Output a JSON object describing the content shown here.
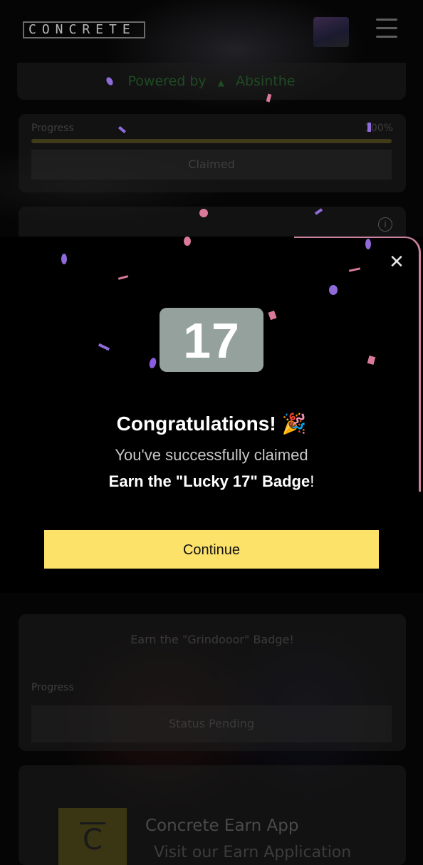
{
  "header": {
    "logo_text": "CONCRETE"
  },
  "powered": {
    "prefix": "Powered by",
    "brand": "Absinthe"
  },
  "quest_claimed": {
    "progress_label": "Progress",
    "progress_value": "100%",
    "status_label": "Claimed"
  },
  "modal": {
    "badge_text": "17",
    "title": "Congratulations!",
    "title_emoji": "🎉",
    "subtitle_line1": "You've successfully claimed",
    "claimed_item": "Earn the \"Lucky 17\" Badge",
    "claimed_item_suffix": "!",
    "continue_label": "Continue",
    "accent_color": "#fde26a"
  },
  "quest_pending": {
    "title": "Earn the \"Grindooor\" Badge!",
    "progress_label": "Progress",
    "status_label": "Status Pending"
  },
  "app_card": {
    "icon_letter": "C",
    "title": "Concrete Earn App",
    "subtitle": "Visit our Earn Application"
  },
  "icons": [
    "menu-icon",
    "close-icon",
    "info-icon",
    "party-popper-icon",
    "triangle-icon"
  ]
}
